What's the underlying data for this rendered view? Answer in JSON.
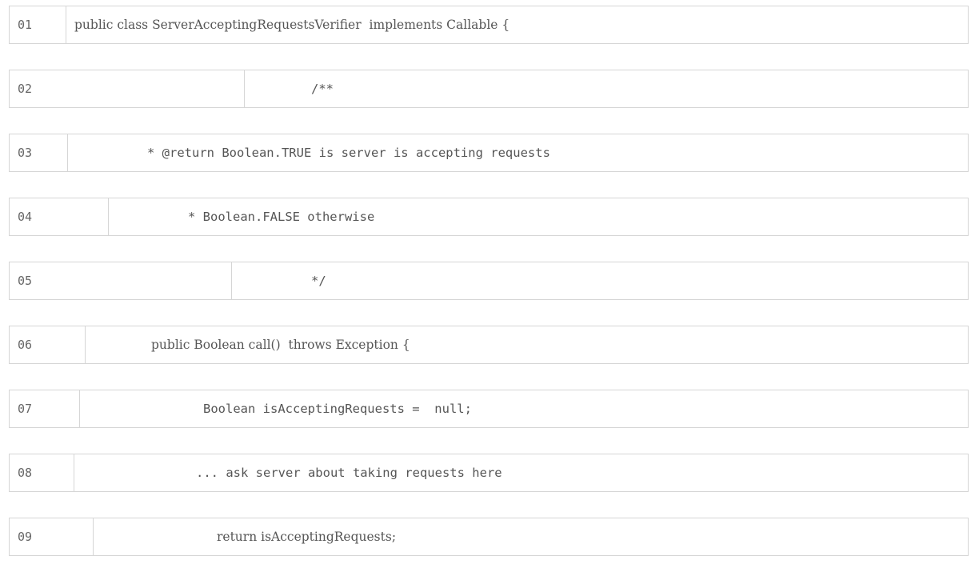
{
  "lines": [
    {
      "number": "01",
      "segments": [
        "public class ServerAcceptingRequestsVerifier  implements Callable {"
      ]
    },
    {
      "number": "02",
      "segments": [
        "/**"
      ]
    },
    {
      "number": "03",
      "segments": [
        "* @return Boolean.TRUE is server is accepting requests"
      ]
    },
    {
      "number": "04",
      "segments": [
        "* Boolean.FALSE otherwise"
      ]
    },
    {
      "number": "05",
      "segments": [
        "*/"
      ]
    },
    {
      "number": "06",
      "segments": [
        "public Boolean call()  throws Exception {"
      ]
    },
    {
      "number": "07",
      "segments": [
        "Boolean isAcceptingRequests =  null;"
      ]
    },
    {
      "number": "08",
      "segments": [
        "... ask server about taking requests here"
      ]
    },
    {
      "number": "09",
      "segments": [
        "return isAcceptingRequests;"
      ]
    }
  ]
}
